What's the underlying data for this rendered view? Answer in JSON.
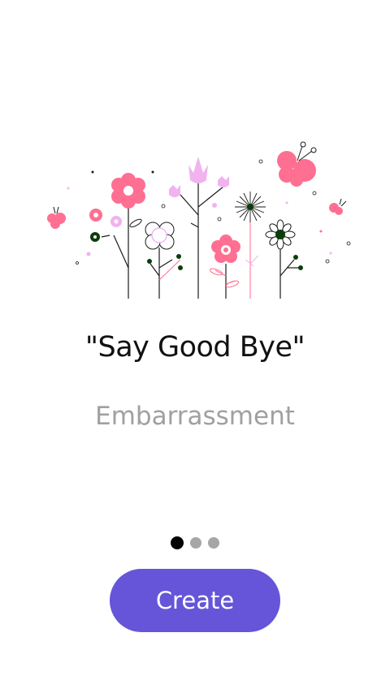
{
  "onboarding": {
    "headline": "\"Say Good Bye\"",
    "subline": "Embarrassment",
    "pager": {
      "total_pages": 3,
      "active_index": 0
    },
    "create_button_label": "Create",
    "illustration_icon": "flowers-butterflies-illustration"
  },
  "colors": {
    "accent": "#6655d8",
    "pink": "#ff6f91",
    "lilac": "#f0b3f0",
    "dot_active": "#000000",
    "dot_inactive": "#a6a6a6"
  }
}
